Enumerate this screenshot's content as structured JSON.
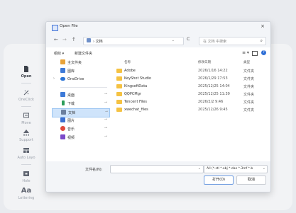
{
  "rail": [
    {
      "label": "Open",
      "icon": "open-icon",
      "active": true
    },
    {
      "label": "OneClick",
      "icon": "oneclick-icon"
    },
    {
      "label": "Move",
      "icon": "move-icon"
    },
    {
      "label": "Support",
      "icon": "support-icon"
    },
    {
      "label": "Auto Layo",
      "icon": "layout-icon"
    },
    {
      "label": "Hole",
      "icon": "hole-icon"
    },
    {
      "label": "Lettering",
      "icon": "lettering-icon",
      "glyph": "Aa"
    }
  ],
  "dialog": {
    "title": "Open File",
    "close": "×",
    "nav": {
      "back": "←",
      "forward": "→",
      "up": "↑"
    },
    "address": {
      "crumb_sep": "›",
      "path": "文档",
      "dropdown": "⌄"
    },
    "refresh": "C",
    "search_placeholder": "在 文档 中搜索",
    "search_icon": "⌕",
    "toolbar": {
      "organize": "组织 ▾",
      "new_folder": "新建文件夹",
      "view": "≡ ▾",
      "help": "?"
    },
    "sidebar": [
      {
        "label": "主文件夹",
        "icon": "home-icon",
        "color": "#e8a33a"
      },
      {
        "label": "图库",
        "icon": "gallery-icon",
        "color": "#3d7ad8"
      },
      {
        "label": "OneDrive",
        "icon": "cloud-icon",
        "color": "#2b74d6",
        "expand": true
      },
      {
        "label": "桌面",
        "icon": "desktop-icon",
        "color": "#3d7ad8",
        "pin": true
      },
      {
        "label": "下载",
        "icon": "download-icon",
        "color": "#2d9d5a",
        "pin": true
      },
      {
        "label": "文档",
        "icon": "documents-icon",
        "color": "#6b7f9e",
        "pin": true,
        "selected": true
      },
      {
        "label": "图片",
        "icon": "pictures-icon",
        "color": "#3b6fd1",
        "pin": true
      },
      {
        "label": "音乐",
        "icon": "music-icon",
        "color": "#e0493b",
        "pin": true
      },
      {
        "label": "视频",
        "icon": "videos-icon",
        "color": "#7b49c9",
        "pin": true
      }
    ],
    "columns": {
      "name": "名称",
      "date": "修改日期",
      "type": "类型"
    },
    "files": [
      {
        "name": "Adobe",
        "date": "2026/1/16 14:22",
        "type": "文件夹"
      },
      {
        "name": "KeyShot Studio",
        "date": "2026/1/29 17:53",
        "type": "文件夹"
      },
      {
        "name": "KingsoftData",
        "date": "2025/12/25 14:04",
        "type": "文件夹"
      },
      {
        "name": "QQPCMgr",
        "date": "2025/12/25 11:39",
        "type": "文件夹"
      },
      {
        "name": "Tencent Files",
        "date": "2026/2/2 9:46",
        "type": "文件夹"
      },
      {
        "name": "xwechat_files",
        "date": "2025/12/26 9:45",
        "type": "文件夹"
      }
    ],
    "filename_label": "文件名(N):",
    "filename_value": "",
    "filter": "All (*.stl *.obj *.dae *.3mf *.b",
    "open": "打开(O)",
    "cancel": "取消"
  }
}
